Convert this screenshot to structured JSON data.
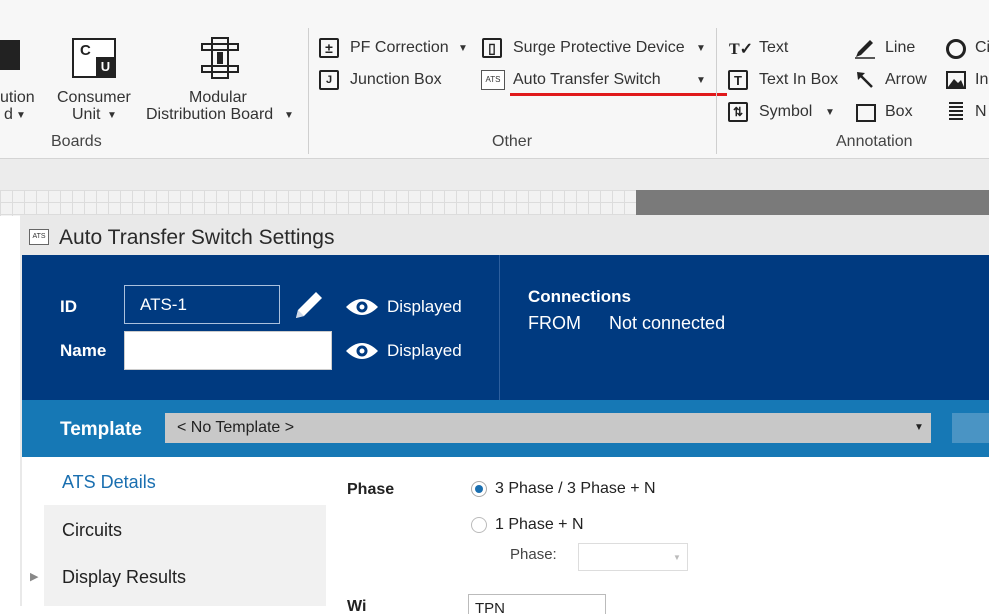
{
  "ribbon": {
    "boards": {
      "label": "Boards",
      "distribution_partial_1": "ution",
      "distribution_partial_2": "d",
      "consumer_unit_1": "Consumer",
      "consumer_unit_2": "Unit",
      "modular_1": "Modular",
      "modular_2": "Distribution Board"
    },
    "other": {
      "label": "Other",
      "pf_correction": "PF Correction",
      "junction_box": "Junction Box",
      "surge_protective_device": "Surge Protective Device",
      "auto_transfer_switch": "Auto Transfer Switch",
      "ats_icon_text": "ATS",
      "junction_icon_text": "J"
    },
    "annotation": {
      "label": "Annotation",
      "text": "Text",
      "text_in_box": "Text In Box",
      "symbol": "Symbol",
      "line": "Line",
      "arrow": "Arrow",
      "box": "Box",
      "partial_ci": "Ci",
      "partial_in": "In",
      "partial_n": "N",
      "text_in_box_icon": "T"
    },
    "consumer_icon_cu": "C",
    "consumer_icon_u": "U"
  },
  "dialog": {
    "icon_text": "ATS",
    "title": "Auto Transfer Switch Settings",
    "id_label": "ID",
    "id_value": "ATS-1",
    "name_label": "Name",
    "name_value": "",
    "displayed_1": "Displayed",
    "displayed_2": "Displayed",
    "connections_title": "Connections",
    "from_label": "FROM",
    "from_value": "Not connected",
    "template_label": "Template",
    "template_value": "< No Template >",
    "nav": [
      "ATS Details",
      "Circuits",
      "Display Results"
    ],
    "phase_label": "Phase",
    "phase_option_1": "3 Phase / 3 Phase + N",
    "phase_option_2": "1 Phase + N",
    "phase_sub_label": "Phase:",
    "partial_label": "Wi",
    "partial_value": "TPN"
  },
  "colors": {
    "header": "#003a80",
    "template_bar": "#1678b5",
    "highlight": "#e0191b"
  }
}
